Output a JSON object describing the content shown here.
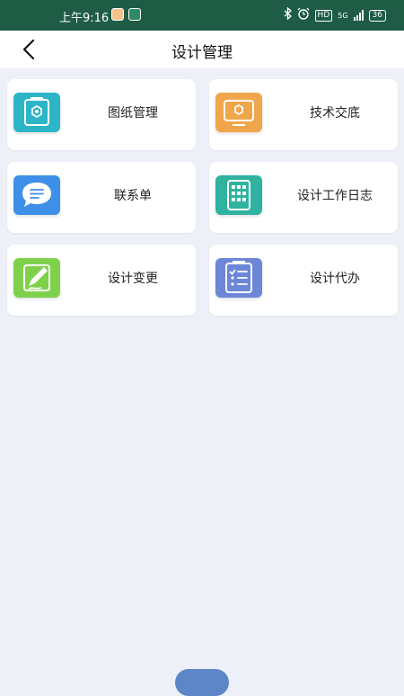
{
  "status_bar": {
    "time": "上午9:16",
    "network": "5G",
    "hd": "HD",
    "battery": "36"
  },
  "header": {
    "title": "设计管理",
    "back_icon": "chevron-left-icon"
  },
  "menu": [
    {
      "label": "图纸管理",
      "icon": "drawing-icon",
      "color": "#2bb5c6"
    },
    {
      "label": "技术交底",
      "icon": "monitor-icon",
      "color": "#f0a64a"
    },
    {
      "label": "联系单",
      "icon": "chat-icon",
      "color": "#3e8fe8"
    },
    {
      "label": "设计工作日志",
      "icon": "calendar-grid-icon",
      "color": "#2fb3a0"
    },
    {
      "label": "设计变更",
      "icon": "pen-edit-icon",
      "color": "#7fd14c"
    },
    {
      "label": "设计代办",
      "icon": "checklist-icon",
      "color": "#6c86d8"
    }
  ]
}
